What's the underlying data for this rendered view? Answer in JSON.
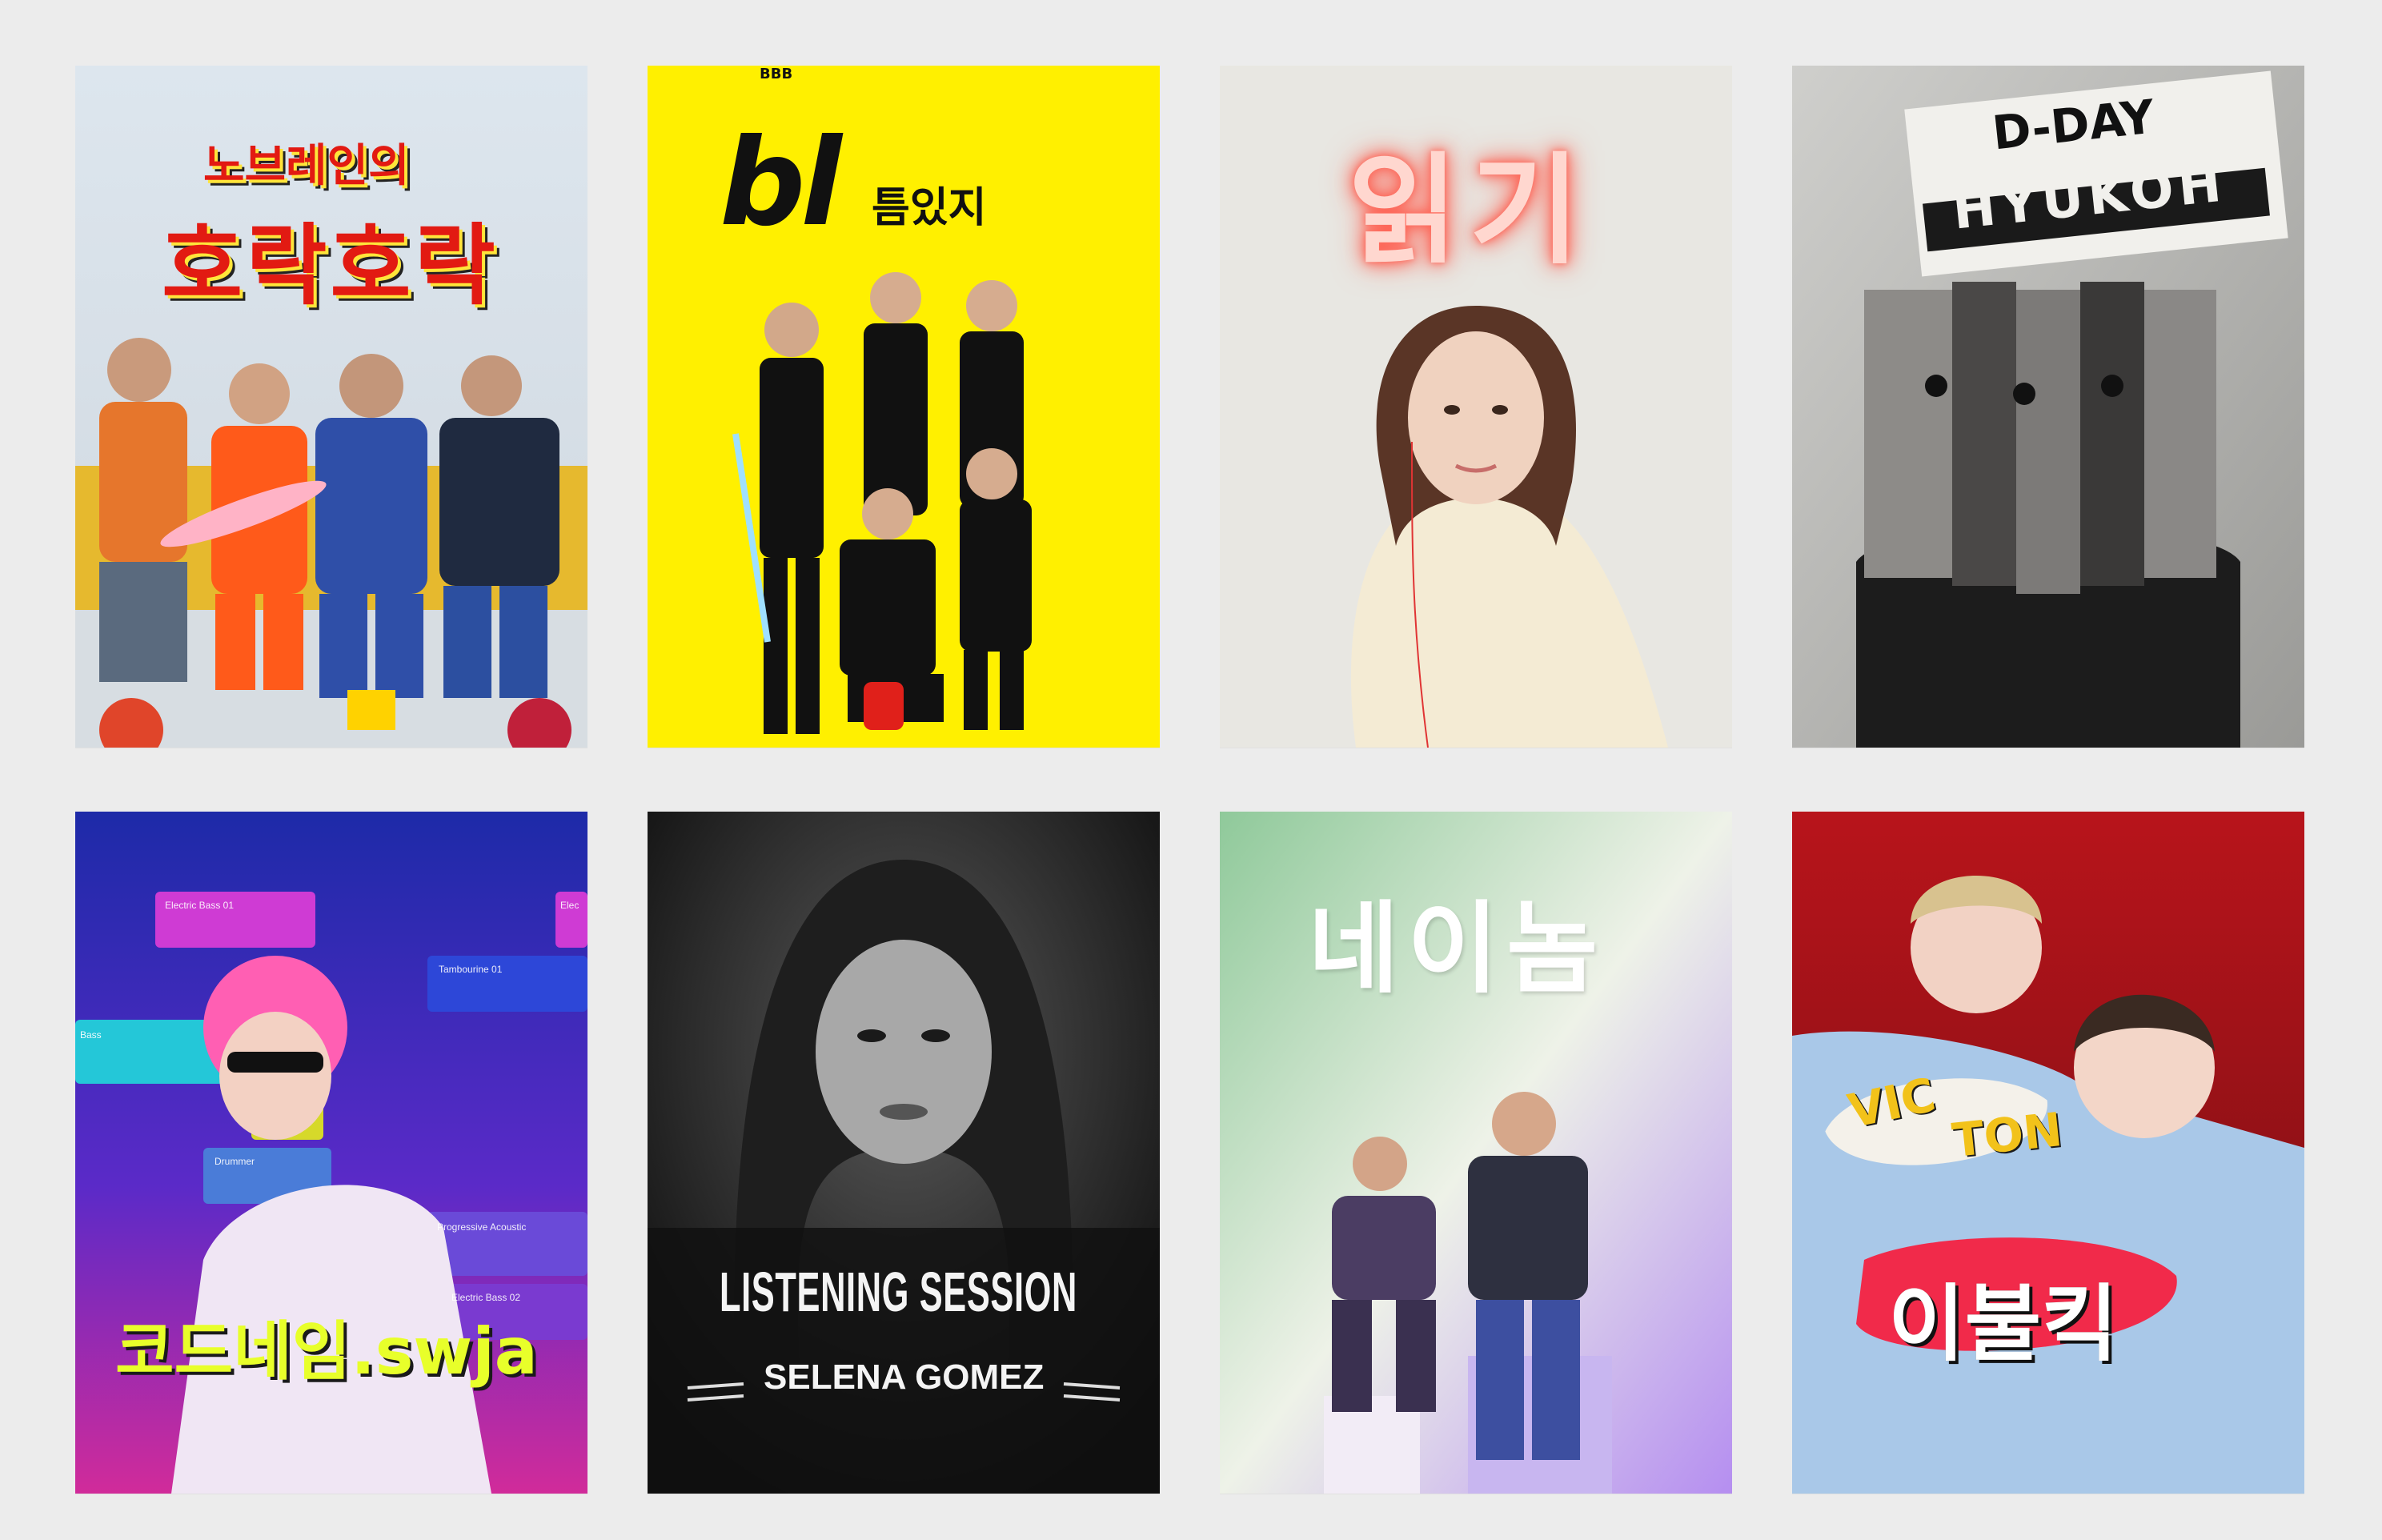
{
  "cards": [
    {
      "title_line1": "노브레인의",
      "title_line2": "호락호락"
    },
    {
      "title_big": "bl",
      "title_small": "틈있지",
      "logo_small": "BBB"
    },
    {
      "title": "읽기"
    },
    {
      "title_line1": "D-DAY",
      "title_line2": "HYUKOH"
    },
    {
      "title": "코드네임.swja",
      "tracks": [
        "Electric Bass 01",
        "Tambourine 01",
        "Bass",
        "Drummer",
        "Progressive Acoustic",
        "Electric Bass 02",
        "Elec"
      ]
    },
    {
      "title_line1": "LISTENING SESSION",
      "title_line2": "SELENA GOMEZ"
    },
    {
      "title": "네이놈"
    },
    {
      "logo": "VICTON",
      "title": "이불킥",
      "logo_v1": "VIC",
      "logo_v2": "TON"
    }
  ],
  "colors": {
    "background": "#ececec",
    "card2_yellow": "#fff000",
    "card8_red": "#b8141b",
    "card5_purple": "#3b1a9c"
  }
}
